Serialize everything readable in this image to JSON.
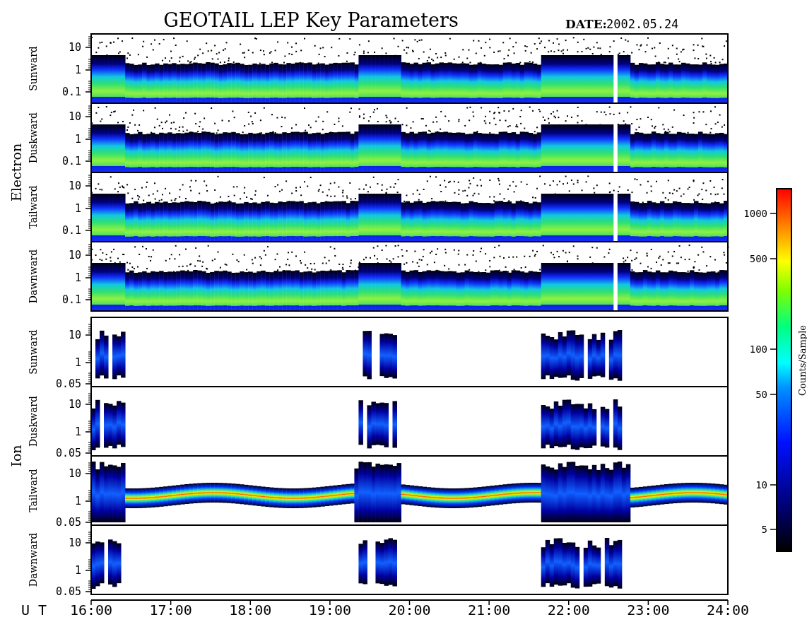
{
  "title": "GEOTAIL LEP Key Parameters",
  "date_label": "DATE:",
  "date": "2002.05.24",
  "groups": [
    {
      "label": "Electron",
      "kind": "electron",
      "panels": [
        {
          "label": "Sunward",
          "yticks": [
            "10",
            "1",
            "0.1"
          ]
        },
        {
          "label": "Duskward",
          "yticks": [
            "10",
            "1",
            "0.1"
          ]
        },
        {
          "label": "Tailward",
          "yticks": [
            "10",
            "1",
            "0.1"
          ]
        },
        {
          "label": "Dawnward",
          "yticks": [
            "10",
            "1",
            "0.1"
          ]
        }
      ]
    },
    {
      "label": "Ion",
      "kind": "ion",
      "panels": [
        {
          "label": "Sunward",
          "yticks": [
            "10",
            "1",
            "0.05"
          ]
        },
        {
          "label": "Duskward",
          "yticks": [
            "10",
            "1",
            "0.05"
          ]
        },
        {
          "label": "Tailward",
          "yticks": [
            "10",
            "1",
            "0.05"
          ]
        },
        {
          "label": "Dawnward",
          "yticks": [
            "10",
            "1",
            "0.05"
          ]
        }
      ]
    }
  ],
  "time_axis": {
    "label": "U T",
    "ticks": [
      "16:00",
      "17:00",
      "18:00",
      "19:00",
      "20:00",
      "21:00",
      "22:00",
      "23:00",
      "24:00"
    ]
  },
  "colorbar": {
    "label": "Counts/Sample",
    "ticks": [
      "1000",
      "500",
      "100",
      "50",
      "10",
      "5"
    ]
  }
}
